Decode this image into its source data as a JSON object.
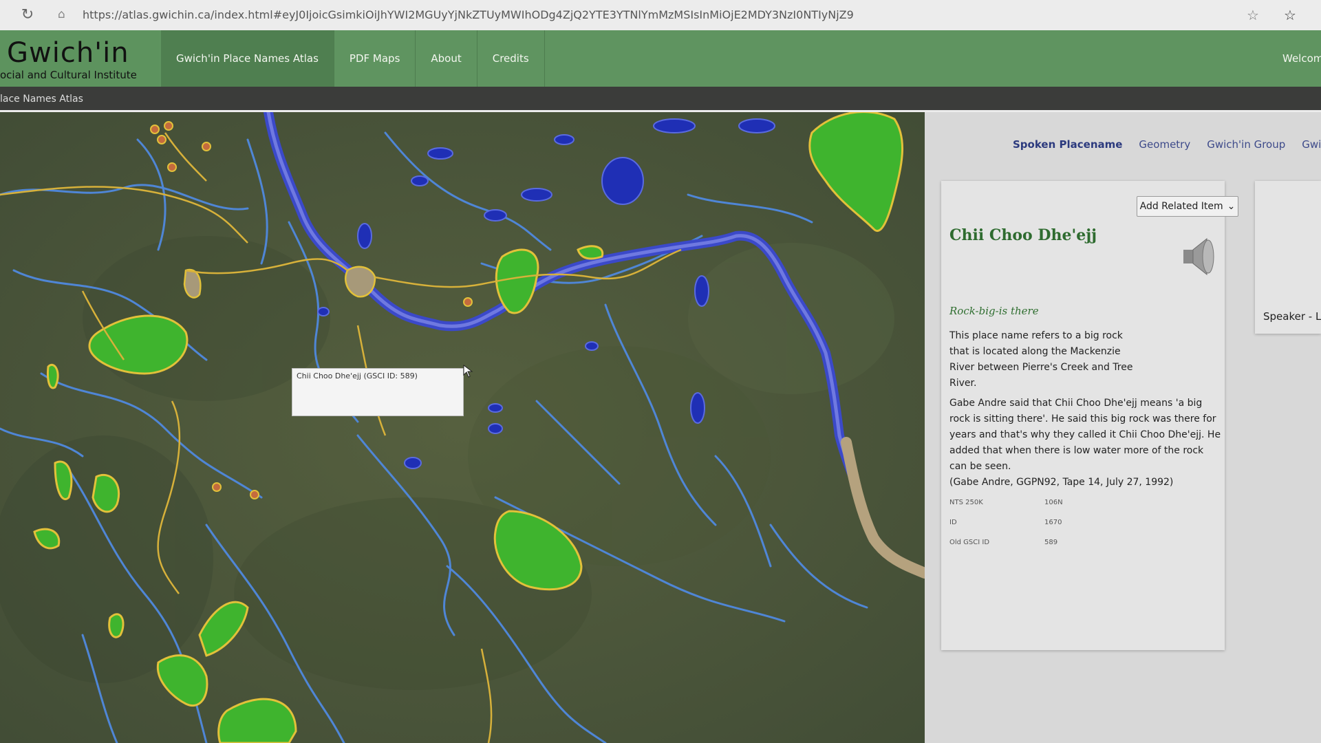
{
  "browser": {
    "url": "https://atlas.gwichin.ca/index.html#eyJ0IjoicGsimkiOiJhYWI2MGUyYjNkZTUyMWIhODg4ZjQ2YTE3YTNlYmMzMSIsInMiOjE2MDY3NzI0NTIyNjZ9",
    "reload_icon": "reload-icon",
    "lock_icon": "lock-icon",
    "bookmark_icon": "star-icon",
    "favorites_icon": "favorites-icon"
  },
  "header": {
    "logo_title": "Gwich'in",
    "logo_subtitle": "ocial and Cultural Institute",
    "nav": [
      {
        "label": "Gwich'in Place Names Atlas"
      },
      {
        "label": "PDF Maps"
      },
      {
        "label": "About"
      },
      {
        "label": "Credits"
      }
    ],
    "welcome": "Welcom",
    "accent": "#5f9460"
  },
  "subheader": {
    "breadcrumb": "lace Names Atlas"
  },
  "map": {
    "popup_text": "Chii Choo Dhe'ejj (GSCI ID: 589)"
  },
  "panel": {
    "tabs": [
      {
        "label": "Spoken Placename"
      },
      {
        "label": "Geometry"
      },
      {
        "label": "Gwich'in Group"
      },
      {
        "label": "Gwich'in"
      }
    ],
    "add_related": "Add Related Item",
    "place_name": "Chii Choo Dhe'ejj",
    "meaning": "Rock-big-is there",
    "description_1": "This place name refers to a big rock that is located along the Mackenzie River between Pierre's Creek and Tree River.",
    "description_2": "Gabe Andre said that Chii Choo Dhe'ejj means 'a big rock is sitting there'. He said this big rock was there for years and that's why they called it Chii Choo Dhe'ejj. He added that when there is low water more of the rock can be seen.",
    "citation": "(Gabe Andre, GGPN92, Tape 14, July 27, 1992)",
    "metadata": [
      {
        "key": "NTS 250K",
        "value": "106N"
      },
      {
        "key": "ID",
        "value": "1670"
      },
      {
        "key": "Old GSCI ID",
        "value": "589"
      }
    ],
    "speaker_label": "Speaker - L",
    "title_color": "#2e6b2f"
  }
}
